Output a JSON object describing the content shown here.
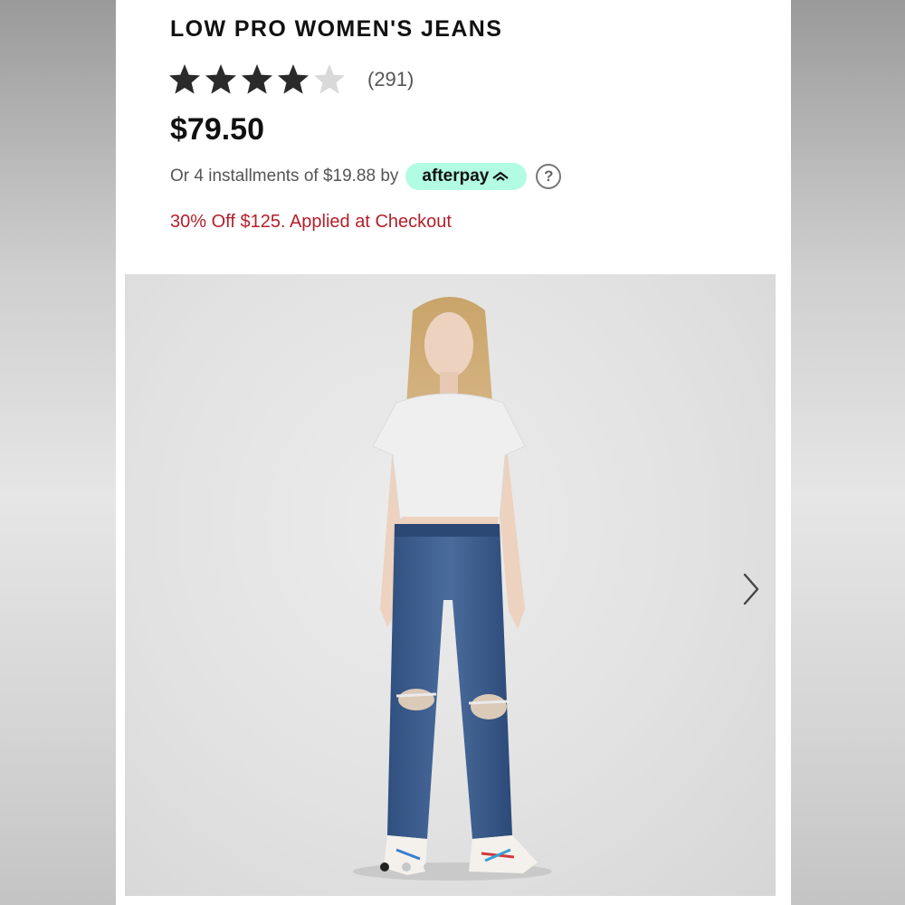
{
  "product": {
    "title": "LOW PRO WOMEN'S JEANS",
    "rating": 4,
    "rating_max": 5,
    "review_count": "(291)",
    "price": "$79.50"
  },
  "installments": {
    "text": "Or 4 installments of $19.88 by",
    "provider": "afterpay",
    "help_icon": "?"
  },
  "promo": {
    "text": "30% Off $125. Applied at Checkout"
  },
  "gallery": {
    "image": "woman-in-white-tee-and-ripped-blue-jeans",
    "next_icon": "chevron-right-icon",
    "total_images": 3,
    "active_index": 0
  },
  "colors": {
    "afterpay_mint": "#b2fce4",
    "promo_red": "#b3202b",
    "star_filled": "#2a2a2a",
    "star_empty": "#d9d9d9"
  }
}
